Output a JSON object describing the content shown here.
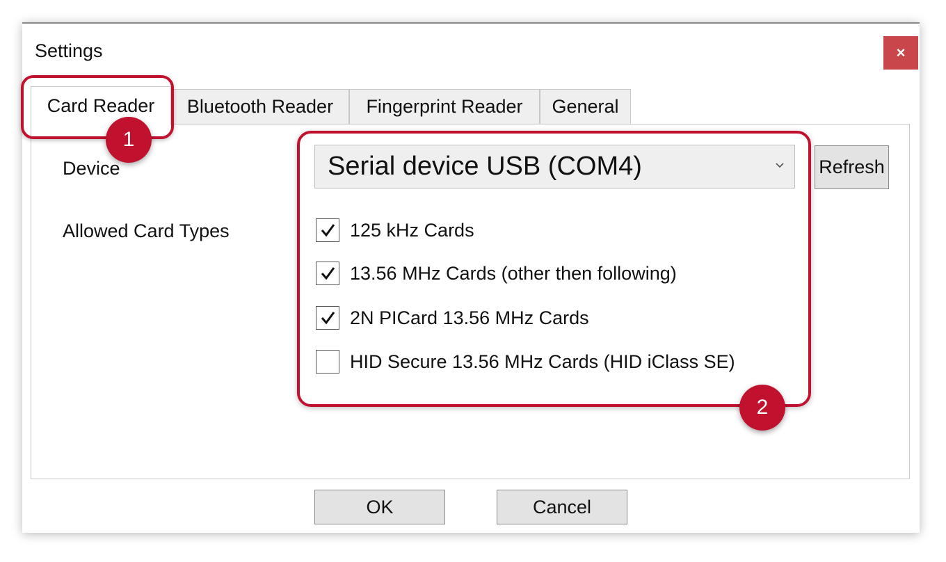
{
  "window": {
    "title": "Settings",
    "close_label": "×"
  },
  "tabs": [
    {
      "label": "Card Reader",
      "active": true
    },
    {
      "label": "Bluetooth Reader",
      "active": false
    },
    {
      "label": "Fingerprint Reader",
      "active": false
    },
    {
      "label": "General",
      "active": false
    }
  ],
  "device": {
    "label": "Device",
    "selected": "Serial device USB (COM4)",
    "refresh_label": "Refresh"
  },
  "card_types": {
    "label": "Allowed Card Types",
    "items": [
      {
        "label": "125 kHz Cards",
        "checked": true
      },
      {
        "label": "13.56 MHz Cards (other then following)",
        "checked": true
      },
      {
        "label": "2N PICard 13.56 MHz Cards",
        "checked": true
      },
      {
        "label": "HID Secure 13.56 MHz Cards (HID iClass SE)",
        "checked": false
      }
    ]
  },
  "footer": {
    "ok_label": "OK",
    "cancel_label": "Cancel"
  },
  "annotations": {
    "badge1": "1",
    "badge2": "2",
    "accent_color": "#c0122f"
  }
}
